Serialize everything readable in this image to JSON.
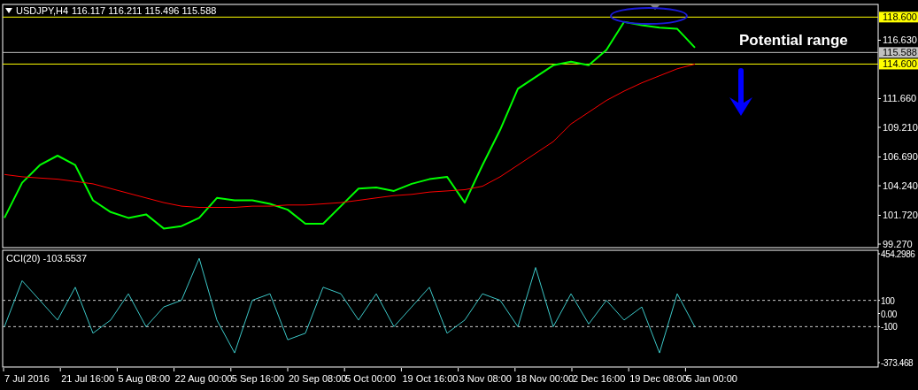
{
  "price_chart": {
    "header": {
      "symbol": "USDJPY,H4",
      "prices": "116.117 116.211 115.496 115.588"
    },
    "chart_data": {
      "type": "line",
      "ylim": [
        98.97,
        119.68
      ],
      "yticks": [
        {
          "value": 116.63,
          "label": "116.630"
        },
        {
          "value": 111.66,
          "label": "111.660"
        },
        {
          "value": 109.21,
          "label": "109.210"
        },
        {
          "value": 106.69,
          "label": "106.690"
        },
        {
          "value": 104.24,
          "label": "104.240"
        },
        {
          "value": 101.72,
          "label": "101.720"
        },
        {
          "value": 99.27,
          "label": "99.270"
        }
      ],
      "series": [
        {
          "color": "#00ff00",
          "values": [
            101.5,
            104.5,
            106,
            106.8,
            106,
            103,
            102,
            101.5,
            101.8,
            100.6,
            100.8,
            101.5,
            103.2,
            103,
            103,
            102.7,
            102.2,
            101,
            101,
            102.5,
            104,
            104.1,
            103.8,
            104.4,
            104.8,
            105,
            102.8,
            106,
            109,
            112.5,
            113.5,
            114.5,
            114.8,
            114.5,
            115.8,
            118.2,
            117.9,
            117.7,
            117.6,
            116
          ]
        },
        {
          "color": "#ff0000",
          "values": [
            105.2,
            105,
            104.9,
            104.8,
            104.6,
            104.4,
            104,
            103.6,
            103.2,
            102.8,
            102.5,
            102.4,
            102.4,
            102.4,
            102.5,
            102.5,
            102.6,
            102.6,
            102.7,
            102.8,
            103,
            103.2,
            103.4,
            103.5,
            103.7,
            103.8,
            103.9,
            104.2,
            105,
            106,
            107,
            108,
            109.5,
            110.5,
            111.5,
            112.3,
            113,
            113.6,
            114.2,
            114.6
          ]
        }
      ],
      "ref_lines": [
        {
          "axis": "y",
          "value": 118.6,
          "label": "118.600",
          "color": "#ffff00"
        },
        {
          "axis": "y",
          "value": 115.588,
          "label": "115.588",
          "color": "#c0c0c0"
        },
        {
          "axis": "y",
          "value": 114.6,
          "label": "114.600",
          "color": "#ffff00"
        }
      ],
      "annotations": [
        {
          "text": "Potential range"
        }
      ]
    }
  },
  "cci_chart": {
    "label": "CCI(20) -103.5537",
    "chart_data": {
      "type": "line",
      "ylim": [
        -407.1,
        481.2
      ],
      "yticks": [
        {
          "value": 454.2986,
          "label": "454.2986"
        },
        {
          "value": 100,
          "label": "100"
        },
        {
          "value": 0,
          "label": "0.00"
        },
        {
          "value": -100,
          "label": "-100"
        },
        {
          "value": -373.468,
          "label": "-373.468"
        }
      ],
      "series": [
        {
          "color": "#3cc8c8",
          "values": [
            -100,
            250,
            100,
            -50,
            200,
            -150,
            -50,
            150,
            -100,
            50,
            100,
            420,
            -50,
            -300,
            100,
            150,
            -200,
            -150,
            200,
            150,
            -50,
            150,
            -100,
            50,
            200,
            -150,
            -50,
            150,
            100,
            -100,
            350,
            -100,
            150,
            -80,
            100,
            -50,
            50,
            -300,
            150,
            -103
          ]
        }
      ]
    }
  },
  "time_axis": [
    "7 Jul 2016",
    "21 Jul 16:00",
    "5 Aug 08:00",
    "22 Aug 00:00",
    "5 Sep 16:00",
    "20 Sep 08:00",
    "5 Oct 00:00",
    "19 Oct 16:00",
    "3 Nov 08:00",
    "18 Nov 00:00",
    "2 Dec 16:00",
    "19 Dec 08:00",
    "5 Jan 00:00"
  ]
}
